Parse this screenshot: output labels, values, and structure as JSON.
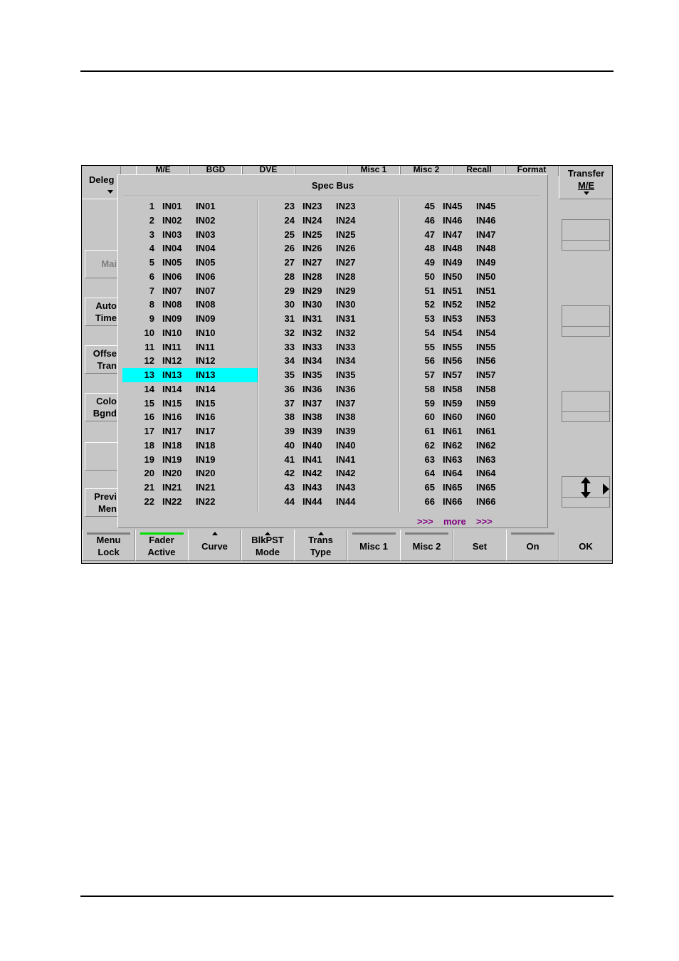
{
  "left_panel": {
    "deleg_label": "Deleg",
    "buttons": [
      {
        "label": "Mai"
      },
      {
        "label1": "Auto",
        "label2": "Time"
      },
      {
        "label1": "Offse",
        "label2": "Tran"
      },
      {
        "label1": "Colo",
        "label2": "Bgnd"
      },
      {
        "label": ""
      },
      {
        "label1": "Previ",
        "label2": "Men"
      }
    ]
  },
  "top_tabs": [
    "M/E",
    "BGD",
    "DVE",
    "",
    "Misc 1",
    "Misc 2",
    "Recall",
    "Format"
  ],
  "transfer": {
    "line1": "Transfer",
    "line2": "M/E"
  },
  "dialog": {
    "title": "Spec Bus",
    "columns": [
      [
        {
          "n": "1",
          "a": "IN01",
          "b": "IN01"
        },
        {
          "n": "2",
          "a": "IN02",
          "b": "IN02"
        },
        {
          "n": "3",
          "a": "IN03",
          "b": "IN03"
        },
        {
          "n": "4",
          "a": "IN04",
          "b": "IN04"
        },
        {
          "n": "5",
          "a": "IN05",
          "b": "IN05"
        },
        {
          "n": "6",
          "a": "IN06",
          "b": "IN06"
        },
        {
          "n": "7",
          "a": "IN07",
          "b": "IN07"
        },
        {
          "n": "8",
          "a": "IN08",
          "b": "IN08"
        },
        {
          "n": "9",
          "a": "IN09",
          "b": "IN09"
        },
        {
          "n": "10",
          "a": "IN10",
          "b": "IN10"
        },
        {
          "n": "11",
          "a": "IN11",
          "b": "IN11"
        },
        {
          "n": "12",
          "a": "IN12",
          "b": "IN12"
        },
        {
          "n": "13",
          "a": "IN13",
          "b": "IN13",
          "selected": true
        },
        {
          "n": "14",
          "a": "IN14",
          "b": "IN14"
        },
        {
          "n": "15",
          "a": "IN15",
          "b": "IN15"
        },
        {
          "n": "16",
          "a": "IN16",
          "b": "IN16"
        },
        {
          "n": "17",
          "a": "IN17",
          "b": "IN17"
        },
        {
          "n": "18",
          "a": "IN18",
          "b": "IN18"
        },
        {
          "n": "19",
          "a": "IN19",
          "b": "IN19"
        },
        {
          "n": "20",
          "a": "IN20",
          "b": "IN20"
        },
        {
          "n": "21",
          "a": "IN21",
          "b": "IN21"
        },
        {
          "n": "22",
          "a": "IN22",
          "b": "IN22"
        }
      ],
      [
        {
          "n": "23",
          "a": "IN23",
          "b": "IN23"
        },
        {
          "n": "24",
          "a": "IN24",
          "b": "IN24"
        },
        {
          "n": "25",
          "a": "IN25",
          "b": "IN25"
        },
        {
          "n": "26",
          "a": "IN26",
          "b": "IN26"
        },
        {
          "n": "27",
          "a": "IN27",
          "b": "IN27"
        },
        {
          "n": "28",
          "a": "IN28",
          "b": "IN28"
        },
        {
          "n": "29",
          "a": "IN29",
          "b": "IN29"
        },
        {
          "n": "30",
          "a": "IN30",
          "b": "IN30"
        },
        {
          "n": "31",
          "a": "IN31",
          "b": "IN31"
        },
        {
          "n": "32",
          "a": "IN32",
          "b": "IN32"
        },
        {
          "n": "33",
          "a": "IN33",
          "b": "IN33"
        },
        {
          "n": "34",
          "a": "IN34",
          "b": "IN34"
        },
        {
          "n": "35",
          "a": "IN35",
          "b": "IN35"
        },
        {
          "n": "36",
          "a": "IN36",
          "b": "IN36"
        },
        {
          "n": "37",
          "a": "IN37",
          "b": "IN37"
        },
        {
          "n": "38",
          "a": "IN38",
          "b": "IN38"
        },
        {
          "n": "39",
          "a": "IN39",
          "b": "IN39"
        },
        {
          "n": "40",
          "a": "IN40",
          "b": "IN40"
        },
        {
          "n": "41",
          "a": "IN41",
          "b": "IN41"
        },
        {
          "n": "42",
          "a": "IN42",
          "b": "IN42"
        },
        {
          "n": "43",
          "a": "IN43",
          "b": "IN43"
        },
        {
          "n": "44",
          "a": "IN44",
          "b": "IN44"
        }
      ],
      [
        {
          "n": "45",
          "a": "IN45",
          "b": "IN45"
        },
        {
          "n": "46",
          "a": "IN46",
          "b": "IN46"
        },
        {
          "n": "47",
          "a": "IN47",
          "b": "IN47"
        },
        {
          "n": "48",
          "a": "IN48",
          "b": "IN48"
        },
        {
          "n": "49",
          "a": "IN49",
          "b": "IN49"
        },
        {
          "n": "50",
          "a": "IN50",
          "b": "IN50"
        },
        {
          "n": "51",
          "a": "IN51",
          "b": "IN51"
        },
        {
          "n": "52",
          "a": "IN52",
          "b": "IN52"
        },
        {
          "n": "53",
          "a": "IN53",
          "b": "IN53"
        },
        {
          "n": "54",
          "a": "IN54",
          "b": "IN54"
        },
        {
          "n": "55",
          "a": "IN55",
          "b": "IN55"
        },
        {
          "n": "56",
          "a": "IN56",
          "b": "IN56"
        },
        {
          "n": "57",
          "a": "IN57",
          "b": "IN57"
        },
        {
          "n": "58",
          "a": "IN58",
          "b": "IN58"
        },
        {
          "n": "59",
          "a": "IN59",
          "b": "IN59"
        },
        {
          "n": "60",
          "a": "IN60",
          "b": "IN60"
        },
        {
          "n": "61",
          "a": "IN61",
          "b": "IN61"
        },
        {
          "n": "62",
          "a": "IN62",
          "b": "IN62"
        },
        {
          "n": "63",
          "a": "IN63",
          "b": "IN63"
        },
        {
          "n": "64",
          "a": "IN64",
          "b": "IN64"
        },
        {
          "n": "65",
          "a": "IN65",
          "b": "IN65"
        },
        {
          "n": "66",
          "a": "IN66",
          "b": "IN66"
        }
      ]
    ],
    "more": {
      "left": ">>>",
      "label": "more",
      "right": ">>>"
    }
  },
  "bottom_buttons": [
    {
      "l1": "Menu",
      "l2": "Lock",
      "indicator": "gray"
    },
    {
      "l1": "Fader",
      "l2": "Active",
      "indicator": "green"
    },
    {
      "l1": "",
      "l2": "Curve",
      "indicator": "arrow"
    },
    {
      "l1": "BlkPST",
      "l2": "Mode",
      "indicator": "arrow"
    },
    {
      "l1": "Trans",
      "l2": "Type",
      "indicator": "arrow"
    },
    {
      "l1": "",
      "l2": "Misc 1",
      "indicator": "gray"
    },
    {
      "l1": "",
      "l2": "Misc 2",
      "indicator": "gray"
    },
    {
      "l1": "",
      "l2": "Set",
      "indicator": "none"
    },
    {
      "l1": "",
      "l2": "On",
      "indicator": "gray"
    },
    {
      "l1": "",
      "l2": "OK",
      "indicator": "none"
    }
  ],
  "colors": {
    "selected_row": "#00ffff",
    "more_text": "#800080",
    "panel_bg": "#c6c6c6",
    "active_indicator": "#00e000"
  },
  "icons": {
    "scroll_arrows": "up-down-arrow-icon",
    "scroll_right": "triangle-right-icon"
  }
}
